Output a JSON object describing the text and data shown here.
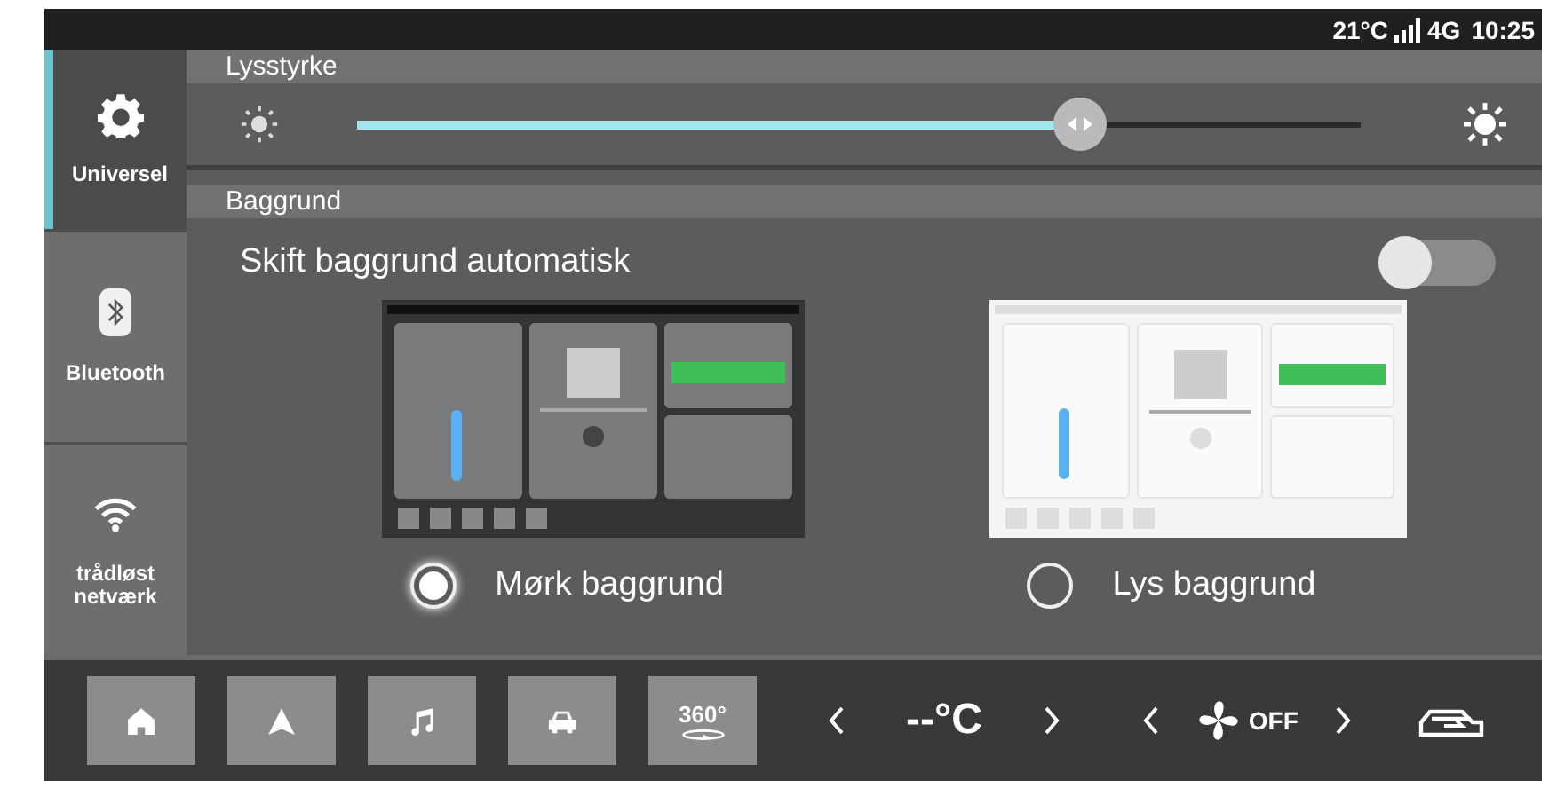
{
  "status_bar": {
    "temperature": "21°C",
    "network": "4G",
    "time": "10:25"
  },
  "sidebar": {
    "items": [
      {
        "label": "Universel",
        "kind": "gear",
        "selected": true
      },
      {
        "label": "Bluetooth",
        "kind": "bluetooth",
        "selected": false
      },
      {
        "label": "trådløst netværk",
        "kind": "wifi",
        "selected": false
      }
    ]
  },
  "brightness": {
    "title": "Lysstyrke",
    "level": 0.72
  },
  "background": {
    "title": "Baggrund",
    "auto_switch": {
      "label": "Skift baggrund automatisk",
      "on": false
    },
    "options": [
      {
        "label": "Mørk baggrund",
        "kind": "dark",
        "selected": true
      },
      {
        "label": "Lys baggrund",
        "kind": "light",
        "selected": false
      }
    ]
  },
  "bottom_bar": {
    "buttons": [
      {
        "kind": "home"
      },
      {
        "kind": "navigation"
      },
      {
        "kind": "music"
      },
      {
        "kind": "car"
      },
      {
        "kind": "rotate",
        "label": "360°"
      }
    ],
    "temperature": "--°C",
    "fan": "OFF"
  }
}
